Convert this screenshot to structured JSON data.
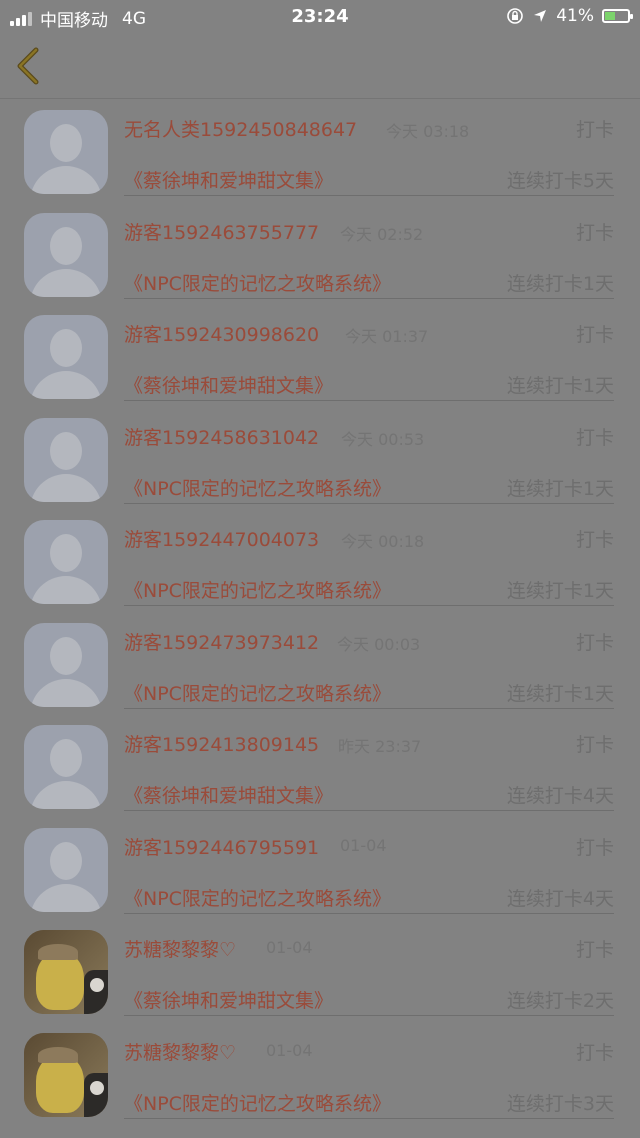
{
  "status": {
    "carrier": "中国移动",
    "network": "4G",
    "time": "23:24",
    "battery": "41%"
  },
  "nav": {
    "back_icon": "chevron-left-icon"
  },
  "items": [
    {
      "name": "无名人类1592450848647",
      "time": "今天 03:18",
      "action": "打卡",
      "book": "《蔡徐坤和爱坤甜文集》",
      "streak": "连续打卡5天",
      "avatar": "default"
    },
    {
      "name": "游客1592463755777",
      "time": "今天 02:52",
      "action": "打卡",
      "book": "《NPC限定的记忆之攻略系统》",
      "streak": "连续打卡1天",
      "avatar": "default"
    },
    {
      "name": "游客1592430998620",
      "time": "今天 01:37",
      "action": "打卡",
      "book": "《蔡徐坤和爱坤甜文集》",
      "streak": "连续打卡1天",
      "avatar": "default"
    },
    {
      "name": "游客1592458631042",
      "time": "今天 00:53",
      "action": "打卡",
      "book": "《NPC限定的记忆之攻略系统》",
      "streak": "连续打卡1天",
      "avatar": "default"
    },
    {
      "name": "游客1592447004073",
      "time": "今天 00:18",
      "action": "打卡",
      "book": "《NPC限定的记忆之攻略系统》",
      "streak": "连续打卡1天",
      "avatar": "default"
    },
    {
      "name": "游客1592473973412",
      "time": "今天 00:03",
      "action": "打卡",
      "book": "《NPC限定的记忆之攻略系统》",
      "streak": "连续打卡1天",
      "avatar": "default"
    },
    {
      "name": "游客1592413809145",
      "time": "昨天 23:37",
      "action": "打卡",
      "book": "《蔡徐坤和爱坤甜文集》",
      "streak": "连续打卡4天",
      "avatar": "default"
    },
    {
      "name": "游客1592446795591",
      "time": "01-04",
      "action": "打卡",
      "book": "《NPC限定的记忆之攻略系统》",
      "streak": "连续打卡4天",
      "avatar": "default"
    },
    {
      "name": "苏糖黎黎黎♡",
      "time": "01-04",
      "action": "打卡",
      "book": "《蔡徐坤和爱坤甜文集》",
      "streak": "连续打卡2天",
      "avatar": "photo"
    },
    {
      "name": "苏糖黎黎黎♡",
      "time": "01-04",
      "action": "打卡",
      "book": "《NPC限定的记忆之攻略系统》",
      "streak": "连续打卡3天",
      "avatar": "photo"
    }
  ]
}
